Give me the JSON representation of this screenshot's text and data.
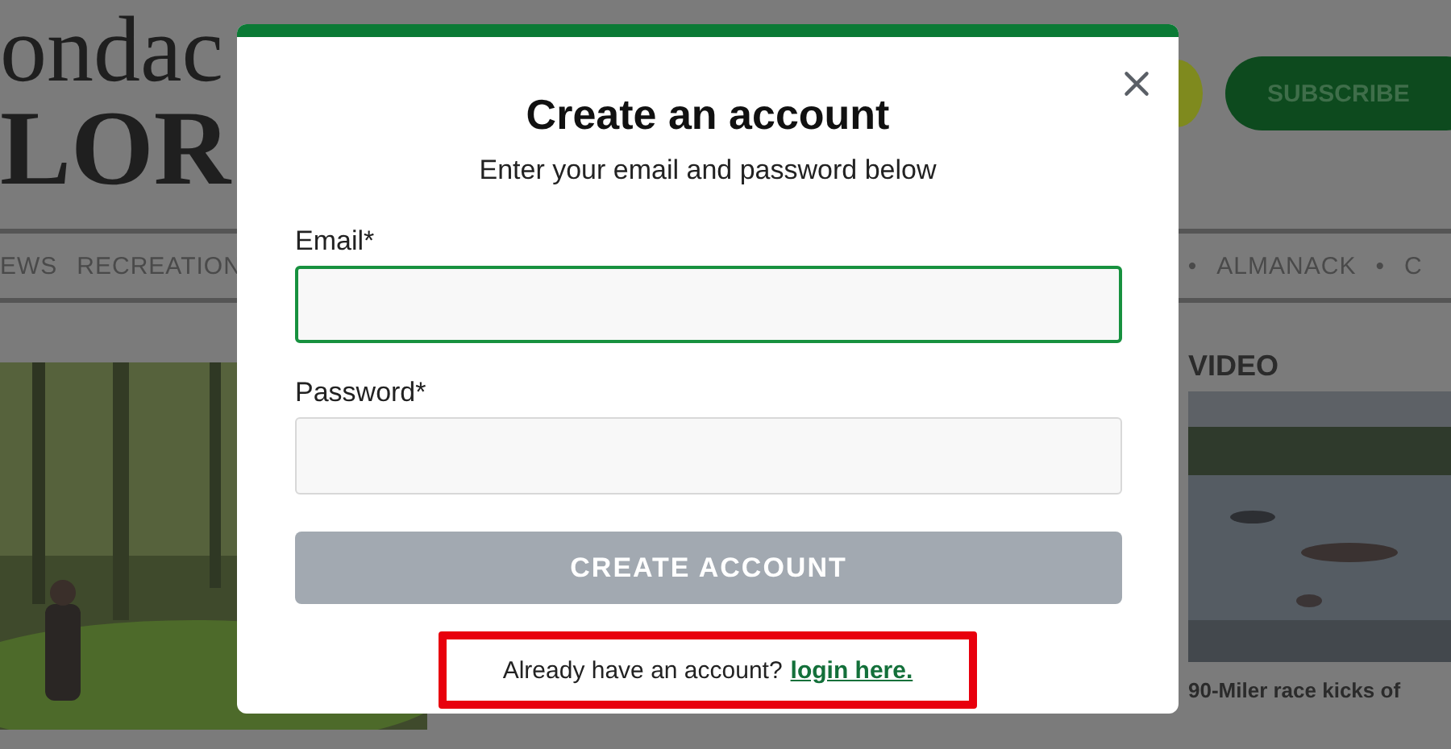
{
  "site": {
    "logo_lines": [
      "ondac",
      "LOR"
    ],
    "subscribe": "SUBSCRIBE",
    "nav": [
      {
        "kind": "link",
        "label": "EWS"
      },
      {
        "kind": "link",
        "label": "RECREATION"
      },
      {
        "kind": "dot",
        "label": "•"
      },
      {
        "kind": "link",
        "label": "ALMANACK"
      },
      {
        "kind": "dot",
        "label": "•"
      },
      {
        "kind": "link",
        "label": "C"
      }
    ],
    "video_heading": "VIDEO",
    "video_caption": "90-Miler race kicks of"
  },
  "modal": {
    "title": "Create an account",
    "subtitle": "Enter your email and password below",
    "fields": [
      {
        "label": "Email*",
        "focused": true
      },
      {
        "label": "Password*",
        "focused": false
      }
    ],
    "button": {
      "label": "CREATE ACCOUNT",
      "disabled": true
    },
    "footer": {
      "text": "Already have an account?",
      "link": "login here.",
      "highlighted": true
    }
  }
}
